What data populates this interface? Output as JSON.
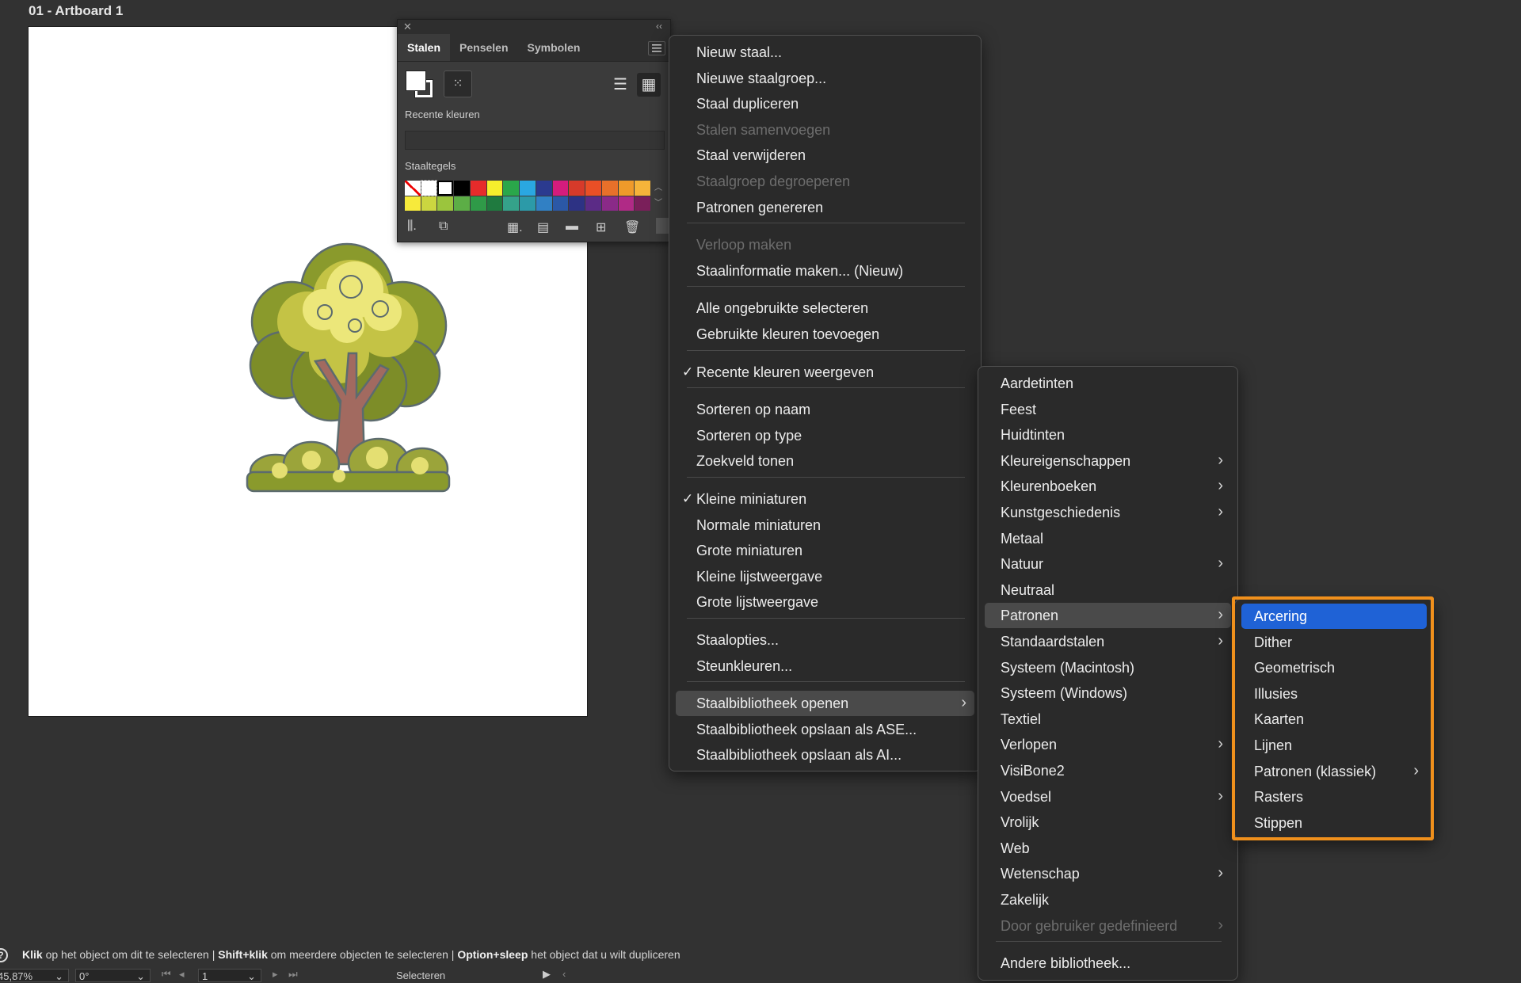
{
  "artboard": {
    "label": "01 - Artboard 1"
  },
  "panel": {
    "tabs": [
      "Stalen",
      "Penselen",
      "Symbolen"
    ],
    "active_tab": "Stalen",
    "recent_label": "Recente kleuren",
    "tiles_label": "Staaltegels",
    "swatches": [
      "none",
      "#ffffff",
      "#ffffff",
      "#000000",
      "#e62b2b",
      "#f6ee2c",
      "#2aa74a",
      "#2aa7e1",
      "#2b3a8f",
      "#d41c7d",
      "#d63a2a",
      "#e94f26",
      "#e8702a",
      "#ef9a2a",
      "#f5b43a",
      "#f7ea3b",
      "#cbd640",
      "#9bc53d",
      "#5cae46",
      "#2f9a48",
      "#1f7a3f",
      "#35a28a",
      "#2c9aa8",
      "#3180c4",
      "#2b58a6",
      "#2d3284",
      "#5b2b86",
      "#8a2a88",
      "#b02a86",
      "#7a1f5a"
    ]
  },
  "main_menu": {
    "items": [
      {
        "label": "Nieuw staal..."
      },
      {
        "label": "Nieuwe staalgroep..."
      },
      {
        "label": "Staal dupliceren"
      },
      {
        "label": "Stalen samenvoegen",
        "disabled": true
      },
      {
        "label": "Staal verwijderen"
      },
      {
        "label": "Staalgroep degroeperen",
        "disabled": true
      },
      {
        "label": "Patronen genereren"
      },
      {
        "label": "Verloop maken",
        "disabled": true
      },
      {
        "label": "Staalinformatie maken... (Nieuw)"
      },
      {
        "label": "Alle ongebruikte selecteren"
      },
      {
        "label": "Gebruikte kleuren toevoegen"
      },
      {
        "label": "Recente kleuren weergeven",
        "checked": true
      },
      {
        "label": "Sorteren op naam"
      },
      {
        "label": "Sorteren op type"
      },
      {
        "label": "Zoekveld tonen"
      },
      {
        "label": "Kleine miniaturen",
        "checked": true
      },
      {
        "label": "Normale miniaturen"
      },
      {
        "label": "Grote miniaturen"
      },
      {
        "label": "Kleine lijstweergave"
      },
      {
        "label": "Grote lijstweergave"
      },
      {
        "label": "Staalopties..."
      },
      {
        "label": "Steunkleuren..."
      },
      {
        "label": "Staalbibliotheek openen",
        "submenu": true,
        "highlight": true
      },
      {
        "label": "Staalbibliotheek opslaan als ASE..."
      },
      {
        "label": "Staalbibliotheek opslaan als AI..."
      }
    ]
  },
  "library_menu": {
    "items": [
      {
        "label": "Aardetinten"
      },
      {
        "label": "Feest"
      },
      {
        "label": "Huidtinten"
      },
      {
        "label": "Kleureigenschappen",
        "submenu": true
      },
      {
        "label": "Kleurenboeken",
        "submenu": true
      },
      {
        "label": "Kunstgeschiedenis",
        "submenu": true
      },
      {
        "label": "Metaal"
      },
      {
        "label": "Natuur",
        "submenu": true
      },
      {
        "label": "Neutraal"
      },
      {
        "label": "Patronen",
        "submenu": true,
        "highlight": true
      },
      {
        "label": "Standaardstalen",
        "submenu": true
      },
      {
        "label": "Systeem (Macintosh)"
      },
      {
        "label": "Systeem (Windows)"
      },
      {
        "label": "Textiel"
      },
      {
        "label": "Verlopen",
        "submenu": true
      },
      {
        "label": "VisiBone2"
      },
      {
        "label": "Voedsel",
        "submenu": true
      },
      {
        "label": "Vrolijk"
      },
      {
        "label": "Web"
      },
      {
        "label": "Wetenschap",
        "submenu": true
      },
      {
        "label": "Zakelijk"
      },
      {
        "label": "Door gebruiker gedefinieerd",
        "submenu": true,
        "disabled": true
      },
      {
        "label": "Andere bibliotheek..."
      }
    ]
  },
  "patterns_menu": {
    "items": [
      {
        "label": "Arcering",
        "selected": true
      },
      {
        "label": "Dither"
      },
      {
        "label": "Geometrisch"
      },
      {
        "label": "Illusies"
      },
      {
        "label": "Kaarten"
      },
      {
        "label": "Lijnen"
      },
      {
        "label": "Patronen (klassiek)",
        "submenu": true
      },
      {
        "label": "Rasters"
      },
      {
        "label": "Stippen"
      }
    ]
  },
  "status": {
    "key1": "Klik",
    "text1": " op het object om dit te selecteren  |  ",
    "key2": "Shift+klik",
    "text2": " om meerdere objecten te selecteren  |  ",
    "key3": "Option+sleep",
    "text3": " het object dat u wilt dupliceren"
  },
  "bottom_bar": {
    "zoom": "45,87%",
    "rotation": "0°",
    "artboard_number": "1",
    "tool": "Selecteren"
  },
  "colors": {
    "highlight": "#1f62d6",
    "callout": "#f0901c"
  }
}
